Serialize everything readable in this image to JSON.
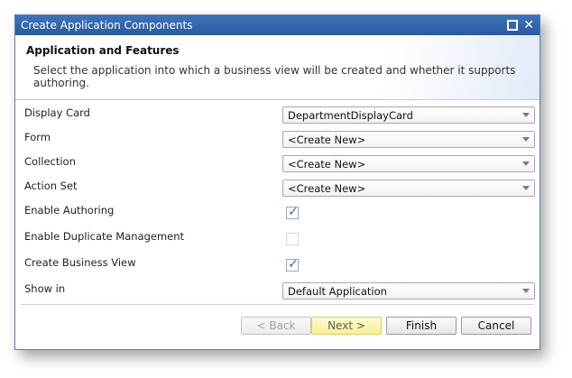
{
  "window": {
    "title": "Create Application Components"
  },
  "header": {
    "title": "Application and Features",
    "description": "Select the application into which a business view will be created and whether it supports authoring."
  },
  "fields": {
    "display_card": {
      "label": "Display Card",
      "value": "DepartmentDisplayCard"
    },
    "form": {
      "label": "Form",
      "value": "<Create New>"
    },
    "collection": {
      "label": "Collection",
      "value": "<Create New>"
    },
    "action_set": {
      "label": "Action Set",
      "value": "<Create New>"
    },
    "enable_authoring": {
      "label": "Enable Authoring",
      "checked": true,
      "enabled": true
    },
    "enable_duplicate_management": {
      "label": "Enable Duplicate Management",
      "checked": false,
      "enabled": false
    },
    "create_business_view": {
      "label": "Create Business View",
      "checked": true,
      "enabled": true
    },
    "show_in": {
      "label": "Show in",
      "value": "Default Application"
    }
  },
  "buttons": {
    "back": "< Back",
    "next": "Next >",
    "finish": "Finish",
    "cancel": "Cancel"
  },
  "colors": {
    "titlebar": "#2f64ac",
    "checkmark": "#3a66aa",
    "next_highlight": "#f7ef98"
  }
}
